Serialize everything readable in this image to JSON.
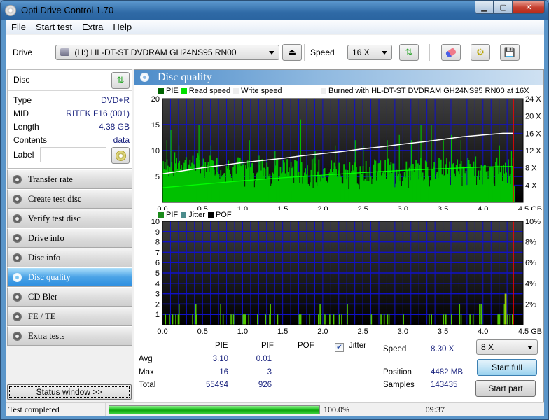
{
  "window": {
    "title": "Opti Drive Control 1.70",
    "controls": [
      "minimize",
      "maximize",
      "close"
    ]
  },
  "menu": [
    "File",
    "Start test",
    "Extra",
    "Help"
  ],
  "toolbar": {
    "drive_label": "Drive",
    "drive_value": "(H:)   HL-DT-ST DVDRAM GH24NS95 RN00",
    "speed_label": "Speed",
    "speed_value": "16 X",
    "icons": [
      "eject-icon",
      "refresh-icon",
      "erase-icon",
      "settings-icon",
      "save-icon"
    ]
  },
  "disc": {
    "header": "Disc",
    "fields": [
      {
        "key": "Type",
        "value": "DVD+R"
      },
      {
        "key": "MID",
        "value": "RITEK F16 (001)"
      },
      {
        "key": "Length",
        "value": "4.38 GB"
      },
      {
        "key": "Contents",
        "value": "data"
      }
    ],
    "label_key": "Label",
    "label_value": ""
  },
  "nav": [
    {
      "label": "Transfer rate",
      "active": false
    },
    {
      "label": "Create test disc",
      "active": false
    },
    {
      "label": "Verify test disc",
      "active": false
    },
    {
      "label": "Drive info",
      "active": false
    },
    {
      "label": "Disc info",
      "active": false
    },
    {
      "label": "Disc quality",
      "active": true
    },
    {
      "label": "CD Bler",
      "active": false
    },
    {
      "label": "FE / TE",
      "active": false
    },
    {
      "label": "Extra tests",
      "active": false
    }
  ],
  "status_window_button": "Status window >>",
  "main": {
    "title": "Disc quality",
    "top_legend": {
      "pie": "PIE",
      "read": "Read speed",
      "write": "Write speed",
      "burned": "Burned with HL-DT-ST DVDRAM GH24NS95 RN00 at 16X"
    },
    "bottom_legend": {
      "pif": "PIF",
      "jitter": "Jitter",
      "pof": "POF"
    },
    "colors": {
      "pie": "#00c000",
      "pie_dark": "#006400",
      "read": "#00ff00",
      "write": "#ffffff",
      "grid": "#0000ff",
      "marker": "#ff0000",
      "pif": "#50c800",
      "jitter": "#4c8c8c",
      "pof": "#000000"
    }
  },
  "chart_data": [
    {
      "type": "bar",
      "title": "PIE / Read speed / Write speed",
      "xlabel": "GB",
      "xlim": [
        0,
        4.5
      ],
      "x_ticks": [
        "0.0",
        "0.5",
        "1.0",
        "1.5",
        "2.0",
        "2.5",
        "3.0",
        "3.5",
        "4.0",
        "4.5 GB"
      ],
      "ylim_left": [
        0,
        20
      ],
      "y_ticks_left": [
        "5",
        "10",
        "15",
        "20"
      ],
      "ylim_right": [
        0,
        24
      ],
      "y_ticks_right": [
        "4 X",
        "8 X",
        "12 X",
        "16 X",
        "20 X",
        "24 X"
      ],
      "end_marker_gb": 4.38,
      "series": [
        {
          "name": "PIE",
          "kind": "bars",
          "baseline_trend": {
            "x": [
              0,
              0.5,
              1,
              1.5,
              2,
              2.5,
              3,
              3.5,
              4,
              4.38
            ],
            "y": [
              8,
              7.5,
              7,
              6.5,
              6.5,
              6.5,
              6.5,
              6.8,
              7,
              7
            ]
          },
          "spikes": [
            {
              "x": 0.05,
              "y": 12
            },
            {
              "x": 0.1,
              "y": 14
            },
            {
              "x": 0.2,
              "y": 11
            },
            {
              "x": 0.45,
              "y": 15
            },
            {
              "x": 0.6,
              "y": 11
            },
            {
              "x": 1.08,
              "y": 12
            },
            {
              "x": 1.2,
              "y": 9
            },
            {
              "x": 1.4,
              "y": 10
            },
            {
              "x": 1.72,
              "y": 16
            },
            {
              "x": 1.9,
              "y": 10
            },
            {
              "x": 2.15,
              "y": 11
            },
            {
              "x": 2.4,
              "y": 12
            },
            {
              "x": 2.5,
              "y": 11
            },
            {
              "x": 2.8,
              "y": 12
            },
            {
              "x": 2.95,
              "y": 13
            },
            {
              "x": 3.1,
              "y": 12
            },
            {
              "x": 3.22,
              "y": 15
            },
            {
              "x": 3.35,
              "y": 15
            },
            {
              "x": 3.5,
              "y": 12
            },
            {
              "x": 3.6,
              "y": 13
            },
            {
              "x": 3.72,
              "y": 12
            },
            {
              "x": 4.2,
              "y": 11
            },
            {
              "x": 4.35,
              "y": 10
            }
          ]
        },
        {
          "name": "Read speed",
          "kind": "line",
          "x": [
            0,
            0.5,
            1.0,
            1.5,
            2.0,
            2.5,
            3.0,
            3.5,
            4.0,
            4.38
          ],
          "y_speed": [
            3.4,
            4.2,
            5.0,
            5.7,
            6.3,
            6.9,
            7.4,
            7.8,
            8.2,
            8.3
          ]
        },
        {
          "name": "Write speed",
          "kind": "line",
          "x": [
            0,
            0.25,
            0.5,
            0.75,
            1.0,
            1.25,
            1.5,
            1.75,
            2.0,
            2.25,
            2.5,
            2.75,
            3.0,
            3.25,
            3.5,
            3.75,
            4.0,
            4.25,
            4.38
          ],
          "y_speed": [
            6.6,
            7.3,
            8.0,
            8.6,
            9.2,
            9.7,
            10.2,
            10.8,
            11.3,
            11.8,
            12.4,
            12.9,
            13.5,
            14.0,
            14.6,
            15.2,
            15.6,
            16.0,
            16.0
          ]
        }
      ]
    },
    {
      "type": "bar",
      "title": "PIF / Jitter / POF",
      "xlabel": "GB",
      "xlim": [
        0,
        4.5
      ],
      "x_ticks": [
        "0.0",
        "0.5",
        "1.0",
        "1.5",
        "2.0",
        "2.5",
        "3.0",
        "3.5",
        "4.0",
        "4.5 GB"
      ],
      "ylim_left": [
        0,
        10
      ],
      "y_ticks_left": [
        "1",
        "2",
        "3",
        "4",
        "5",
        "6",
        "7",
        "8",
        "9",
        "10"
      ],
      "ylim_right": [
        0,
        10
      ],
      "y_ticks_right": [
        "2%",
        "4%",
        "6%",
        "8%",
        "10%"
      ],
      "end_marker_gb": 4.38,
      "series": [
        {
          "name": "PIF",
          "x": [
            0.03,
            0.08,
            0.12,
            0.16,
            0.19,
            0.2,
            0.37,
            0.41,
            0.42,
            0.72,
            0.75,
            0.85,
            0.88,
            1.0,
            1.02,
            1.03,
            1.07,
            1.18,
            1.28,
            1.33,
            1.34,
            1.43,
            1.7,
            1.72,
            1.83,
            1.94,
            1.96,
            1.97,
            2.02,
            2.08,
            2.13,
            2.2,
            2.23,
            2.3,
            2.6,
            2.72,
            2.76,
            2.8,
            2.82,
            3.0,
            3.32,
            3.35,
            3.5,
            3.53,
            3.6,
            3.7,
            3.72,
            3.83,
            3.87,
            3.95,
            3.97,
            3.98,
            4.18,
            4.2,
            4.26,
            4.27,
            4.28,
            4.3,
            4.33,
            4.36
          ],
          "y": [
            1,
            1,
            1,
            1,
            1,
            2,
            1,
            2,
            1,
            2,
            1,
            1,
            1,
            1,
            1,
            1,
            1,
            1,
            1,
            1,
            2,
            1,
            1,
            1,
            1,
            1,
            2,
            1,
            1,
            1,
            1,
            1,
            1,
            2,
            1,
            1,
            1,
            1,
            1,
            1,
            1,
            1,
            1,
            1,
            1,
            2,
            1,
            1,
            1,
            2,
            2,
            1,
            1,
            1,
            2,
            3,
            3,
            1,
            1,
            1
          ]
        },
        {
          "name": "Jitter",
          "x": [],
          "y": []
        },
        {
          "name": "POF",
          "x": [],
          "y": []
        }
      ]
    }
  ],
  "stats": {
    "columns": [
      "PIE",
      "PIF",
      "POF"
    ],
    "jitter_label": "Jitter",
    "jitter_checked": true,
    "rows": [
      {
        "label": "Avg",
        "pie": "3.10",
        "pif": "0.01"
      },
      {
        "label": "Max",
        "pie": "16",
        "pif": "3"
      },
      {
        "label": "Total",
        "pie": "55494",
        "pif": "926"
      }
    ],
    "speed_label": "Speed",
    "speed_value": "8.30 X",
    "position_label": "Position",
    "position_value": "4482 MB",
    "samples_label": "Samples",
    "samples_value": "143435",
    "test_speed": "8 X",
    "start_full": "Start full",
    "start_part": "Start part"
  },
  "statusbar": {
    "message": "Test completed",
    "progress": 1.0,
    "progress_text": "100.0%",
    "time": "09:37"
  }
}
